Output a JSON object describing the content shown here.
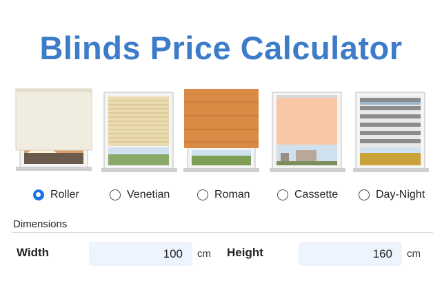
{
  "page": {
    "title": "Blinds Price Calculator"
  },
  "colors": {
    "title": "#3d7cc9",
    "input_background": "#eef4fd",
    "radio_checked": "#1a73e8"
  },
  "blind_types": {
    "selected": "Roller",
    "options": [
      {
        "label": "Roller",
        "image": "roller-blind-window-image",
        "fabric": "#f1ece0"
      },
      {
        "label": "Venetian",
        "image": "venetian-blind-window-image",
        "fabric": "#eadbb0"
      },
      {
        "label": "Roman",
        "image": "roman-blind-window-image",
        "fabric": "#d98a45"
      },
      {
        "label": "Cassette",
        "image": "cassette-blind-window-image",
        "fabric": "#f8c8a4"
      },
      {
        "label": "Day-Night",
        "image": "day-night-blind-window-image",
        "fabric": "#8c8c8c"
      }
    ]
  },
  "dimensions": {
    "section_label": "Dimensions",
    "width": {
      "label": "Width",
      "value": "100",
      "unit": "cm"
    },
    "height": {
      "label": "Height",
      "value": "160",
      "unit": "cm"
    }
  }
}
